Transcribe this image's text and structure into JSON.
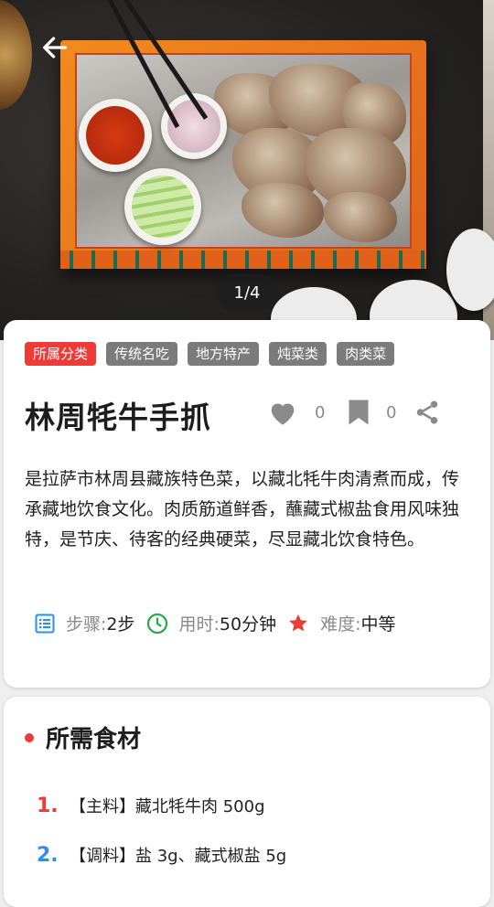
{
  "hero": {
    "pager_text": "1/4",
    "back_icon": "arrow-left-icon"
  },
  "tags": [
    {
      "label": "所属分类",
      "primary": true
    },
    {
      "label": "传统名吃"
    },
    {
      "label": "地方特产"
    },
    {
      "label": "炖菜类"
    },
    {
      "label": "肉类菜"
    }
  ],
  "recipe": {
    "title": "林周牦牛手抓",
    "like_count": "0",
    "bookmark_count": "0",
    "description": "是拉萨市林周县藏族特色菜，以藏北牦牛肉清煮而成，传承藏地饮食文化。肉质筋道鲜香，蘸藏式椒盐食用风味独特，是节庆、待客的经典硬菜，尽显藏北饮食特色。"
  },
  "meta": {
    "steps_label": "步骤: ",
    "steps_value": "2步",
    "time_label": "用时: ",
    "time_value": "50分钟",
    "difficulty_label": "难度: ",
    "difficulty_value": "中等"
  },
  "ingredients": {
    "title": "所需食材",
    "items": [
      {
        "num": "1.",
        "text": "【主料】藏北牦牛肉 500g",
        "color": "#ee3b36"
      },
      {
        "num": "2.",
        "text": "【调料】盐 3g、藏式椒盐 5g",
        "color": "#2d8ef0"
      }
    ]
  },
  "colors": {
    "accent": "#ee3b36",
    "tag_gray": "#7b7b7b",
    "steps_icon": "#2d8ef0",
    "time_icon": "#2aa84a",
    "difficulty_icon": "#ee3b36"
  }
}
